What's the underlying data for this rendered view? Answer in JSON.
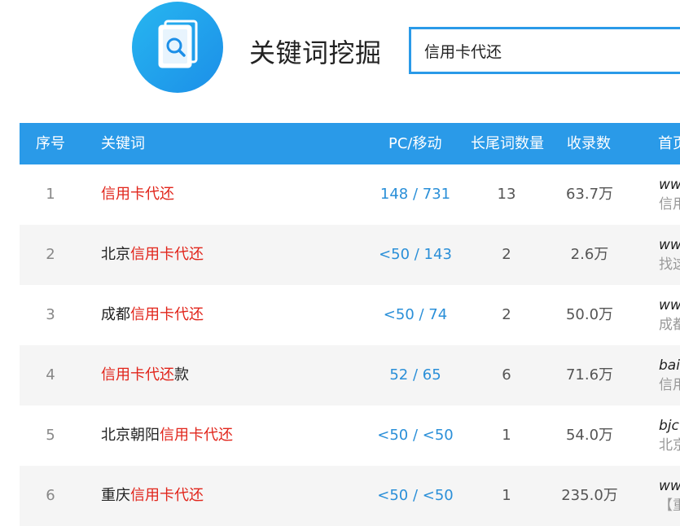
{
  "header": {
    "title": "关键词挖掘",
    "search_value": "信用卡代还"
  },
  "table": {
    "headers": {
      "index": "序号",
      "keyword": "关键词",
      "pc_mobile": "PC/移动",
      "long_tail": "长尾词数量",
      "records": "收录数",
      "home": "首页"
    },
    "rows": [
      {
        "index": "1",
        "kw_pre": "",
        "kw_hl": "信用卡代还",
        "kw_post": "",
        "pc_mobile": "148 / 731",
        "long_tail": "13",
        "records": "63.7万",
        "home_url": "ww",
        "home_text": "信用"
      },
      {
        "index": "2",
        "kw_pre": "北京",
        "kw_hl": "信用卡代还",
        "kw_post": "",
        "pc_mobile": "<50 / 143",
        "long_tail": "2",
        "records": "2.6万",
        "home_url": "ww",
        "home_text": "找这"
      },
      {
        "index": "3",
        "kw_pre": "成都",
        "kw_hl": "信用卡代还",
        "kw_post": "",
        "pc_mobile": "<50 / 74",
        "long_tail": "2",
        "records": "50.0万",
        "home_url": "ww",
        "home_text": "成都"
      },
      {
        "index": "4",
        "kw_pre": "",
        "kw_hl": "信用卡代还",
        "kw_post": "款",
        "pc_mobile": "52 / 65",
        "long_tail": "6",
        "records": "71.6万",
        "home_url": "bai",
        "home_text": "信用"
      },
      {
        "index": "5",
        "kw_pre": "北京朝阳",
        "kw_hl": "信用卡代还",
        "kw_post": "",
        "pc_mobile": "<50 / <50",
        "long_tail": "1",
        "records": "54.0万",
        "home_url": "bjc",
        "home_text": "北京"
      },
      {
        "index": "6",
        "kw_pre": "重庆",
        "kw_hl": "信用卡代还",
        "kw_post": "",
        "pc_mobile": "<50 / <50",
        "long_tail": "1",
        "records": "235.0万",
        "home_url": "ww",
        "home_text": "【重"
      }
    ]
  },
  "colors": {
    "accent": "#2a9ae8",
    "highlight": "#e1251b",
    "link": "#2a8fd8"
  },
  "icons": {
    "logo": "magnifier-document-icon"
  }
}
